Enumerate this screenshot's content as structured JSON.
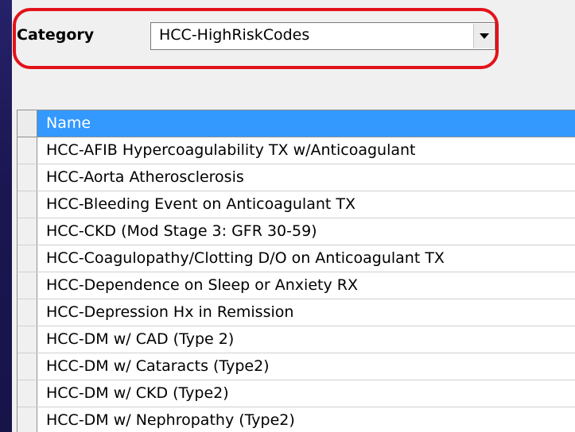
{
  "category": {
    "label": "Category",
    "selected_value": "HCC-HighRiskCodes"
  },
  "grid": {
    "header": "Name",
    "rows": [
      "HCC-AFIB Hypercoagulability TX w/Anticoagulant",
      "HCC-Aorta Atherosclerosis",
      "HCC-Bleeding Event on Anticoagulant TX",
      "HCC-CKD (Mod Stage 3: GFR 30-59)",
      "HCC-Coagulopathy/Clotting D/O on Anticoagulant TX",
      "HCC-Dependence on Sleep or Anxiety RX",
      "HCC-Depression Hx in Remission",
      "HCC-DM w/ CAD (Type 2)",
      "HCC-DM w/ Cataracts (Type2)",
      "HCC-DM w/ CKD (Type2)",
      "HCC-DM w/ Nephropathy (Type2)"
    ]
  },
  "icons": {
    "dropdown": "chevron-down-icon"
  },
  "colors": {
    "header_highlight": "#3399ff",
    "annotation_oval": "#e3121a",
    "background": "#1b1850"
  }
}
